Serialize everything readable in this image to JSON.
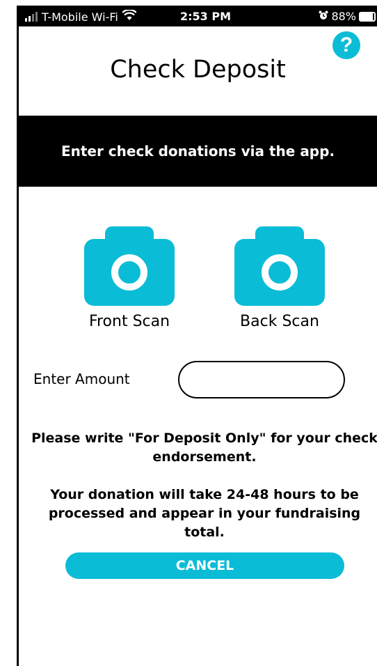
{
  "status_bar": {
    "carrier": "T-Mobile Wi-Fi",
    "time": "2:53 PM",
    "battery": "88%",
    "battery_level": 0.88
  },
  "header": {
    "help_label": "?",
    "title": "Check Deposit"
  },
  "banner": {
    "text": "Enter check donations via the app."
  },
  "scans": {
    "front_label": "Front Scan",
    "back_label": "Back Scan"
  },
  "amount": {
    "label": "Enter Amount",
    "value": "",
    "placeholder": ""
  },
  "notes": {
    "endorsement": "Please write \"For Deposit Only\" for your check endorsement.",
    "processing": "Your donation will take 24-48 hours to be processed and appear in your fundraising total."
  },
  "actions": {
    "cancel_label": "CANCEL"
  },
  "colors": {
    "accent": "#0bbcd6",
    "banner_bg": "#000000"
  },
  "icons": {
    "help": "question-circle-icon",
    "camera": "camera-icon",
    "wifi": "wifi-icon",
    "alarm": "alarm-icon",
    "battery": "battery-icon",
    "signal": "signal-icon"
  }
}
